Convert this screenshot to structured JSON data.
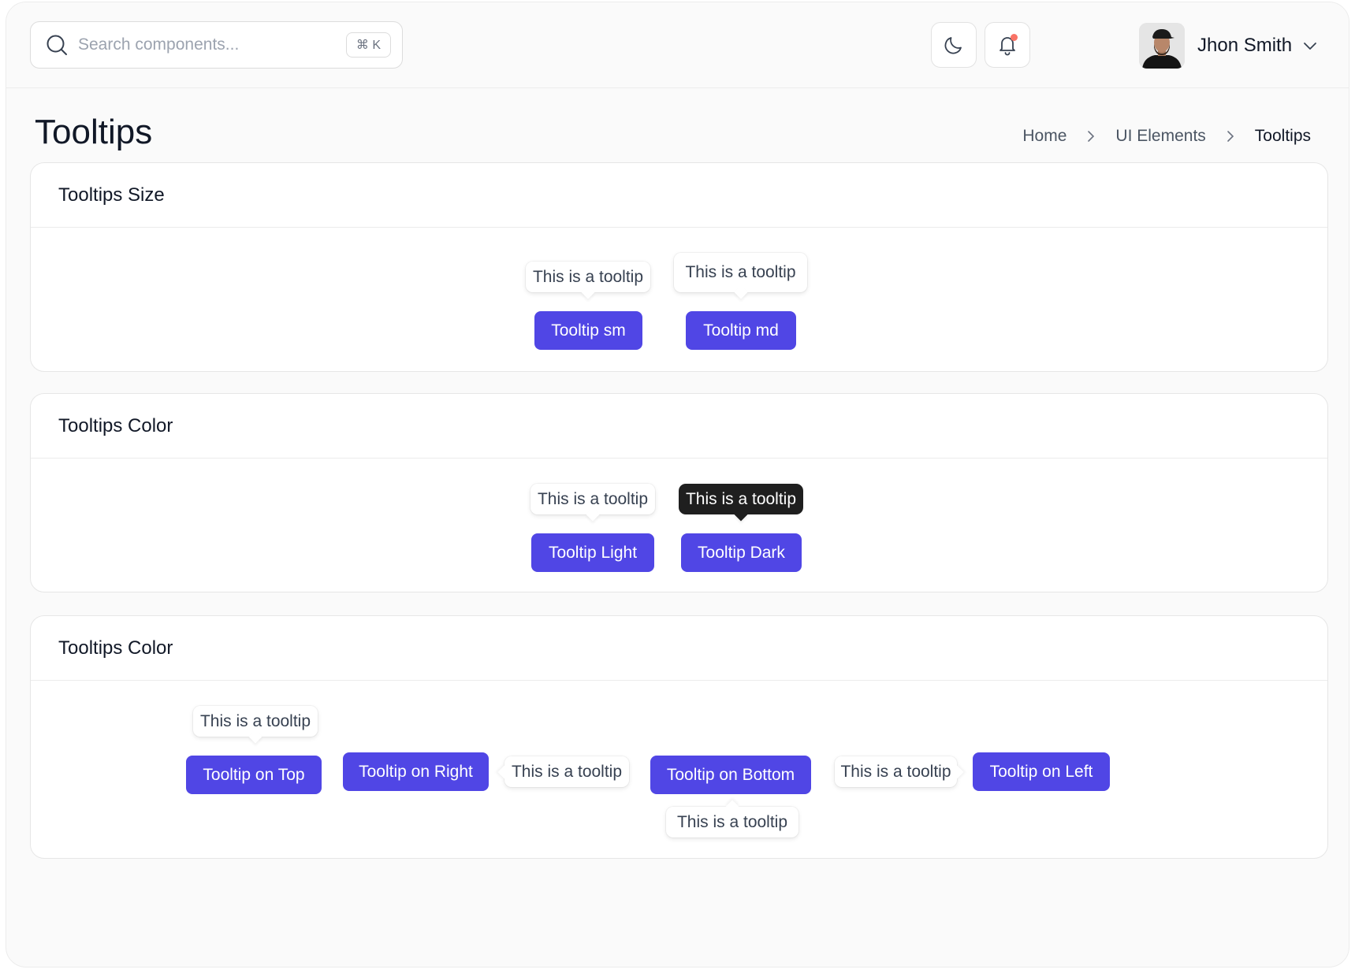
{
  "header": {
    "search": {
      "placeholder": "Search components...",
      "shortcut": "⌘ K"
    },
    "user": {
      "name": "Jhon Smith"
    }
  },
  "page": {
    "title": "Tooltips",
    "breadcrumb": [
      "Home",
      "UI Elements",
      "Tooltips"
    ]
  },
  "cards": [
    {
      "title": "Tooltips Size",
      "items": [
        {
          "button": "Tooltip sm",
          "tooltip": "This is a tooltip"
        },
        {
          "button": "Tooltip md",
          "tooltip": "This is a tooltip"
        }
      ]
    },
    {
      "title": "Tooltips Color",
      "items": [
        {
          "button": "Tooltip Light",
          "tooltip": "This is a tooltip"
        },
        {
          "button": "Tooltip Dark",
          "tooltip": "This is a tooltip"
        }
      ]
    },
    {
      "title": "Tooltips Color",
      "items": [
        {
          "button": "Tooltip on Top",
          "tooltip": "This is a tooltip"
        },
        {
          "button": "Tooltip on Right",
          "tooltip": "This is a tooltip"
        },
        {
          "button": "Tooltip on Bottom",
          "tooltip": "This is a tooltip"
        },
        {
          "button": "Tooltip on Left",
          "tooltip": "This is a tooltip"
        }
      ]
    }
  ],
  "colors": {
    "primary": "#5046e5",
    "dark_tooltip": "#1f1f1f",
    "notification_dot": "#f97366"
  }
}
